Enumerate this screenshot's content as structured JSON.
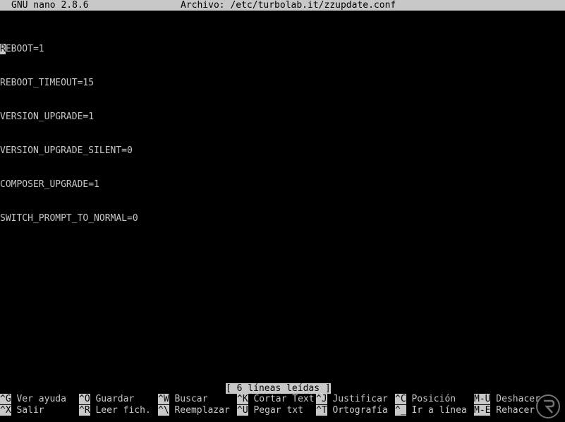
{
  "titlebar": {
    "app": "GNU nano 2.8.6",
    "file": "Archivo: /etc/turbolab.it/zzupdate.conf"
  },
  "editor": {
    "lines": [
      "REBOOT=1",
      "REBOOT_TIMEOUT=15",
      "VERSION_UPGRADE=1",
      "VERSION_UPGRADE_SILENT=0",
      "COMPOSER_UPGRADE=1",
      "SWITCH_PROMPT_TO_NORMAL=0"
    ]
  },
  "status": {
    "message": "[ 6 líneas leídas ]"
  },
  "shortcuts": {
    "row1": [
      {
        "key": "^G",
        "label": " Ver ayuda"
      },
      {
        "key": "^O",
        "label": " Guardar"
      },
      {
        "key": "^W",
        "label": " Buscar"
      },
      {
        "key": "^K",
        "label": " Cortar Text"
      },
      {
        "key": "^J",
        "label": " Justificar"
      },
      {
        "key": "^C",
        "label": " Posición"
      },
      {
        "key": "M-U",
        "label": " Deshacer"
      }
    ],
    "row2": [
      {
        "key": "^X",
        "label": " Salir"
      },
      {
        "key": "^R",
        "label": " Leer fich."
      },
      {
        "key": "^\\",
        "label": " Reemplazar"
      },
      {
        "key": "^U",
        "label": " Pegar txt"
      },
      {
        "key": "^T",
        "label": " Ortografía"
      },
      {
        "key": "^_",
        "label": " Ir a línea"
      },
      {
        "key": "M-E",
        "label": " Rehacer"
      }
    ]
  },
  "colors": {
    "background": "#000000",
    "foreground": "#c8c8c8",
    "inverse_fg": "#000000"
  }
}
